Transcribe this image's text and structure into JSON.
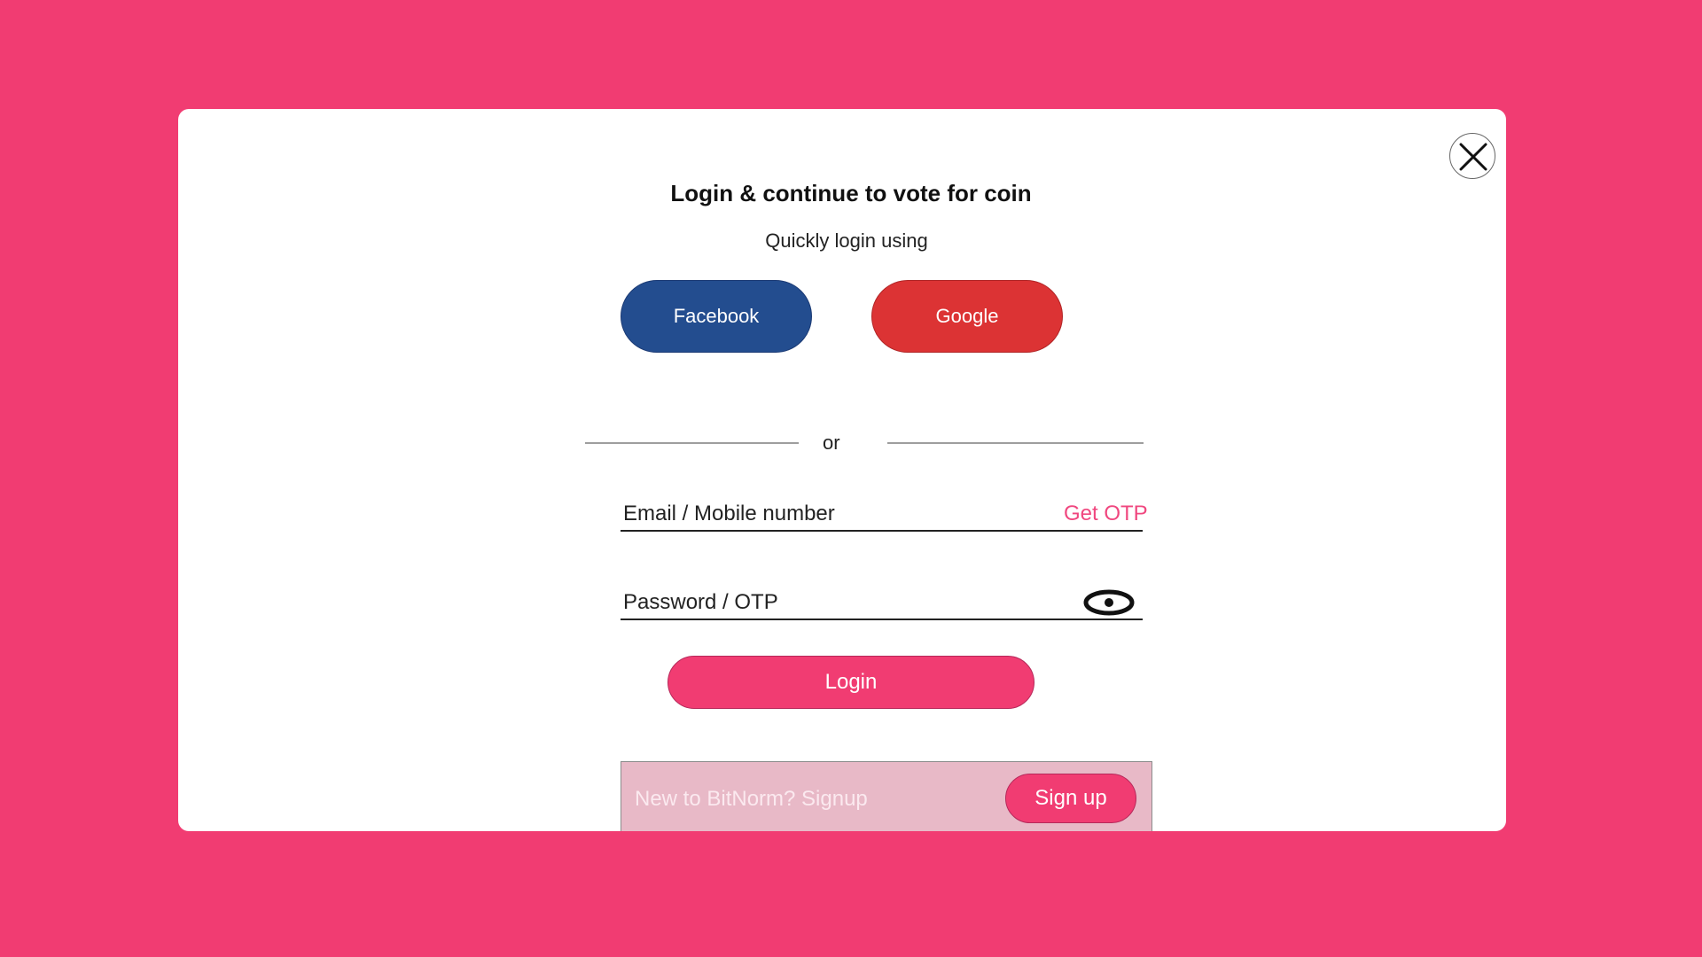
{
  "modal": {
    "title": "Login & continue to vote for coin",
    "subtitle": "Quickly login using",
    "close_icon": "close-icon"
  },
  "social": {
    "facebook_label": "Facebook",
    "google_label": "Google",
    "facebook_color": "#234d8f",
    "google_color": "#dc3334"
  },
  "divider": {
    "text": "or"
  },
  "form": {
    "email_label": "Email / Mobile number",
    "get_otp_label": "Get OTP",
    "password_label": "Password / OTP",
    "eye_icon": "eye-icon",
    "login_label": "Login"
  },
  "signup": {
    "prompt": "New to BitNorm? Signup",
    "button_label": "Sign up"
  },
  "colors": {
    "background": "#f13c72",
    "accent": "#f13c72",
    "link": "#f0477f"
  }
}
